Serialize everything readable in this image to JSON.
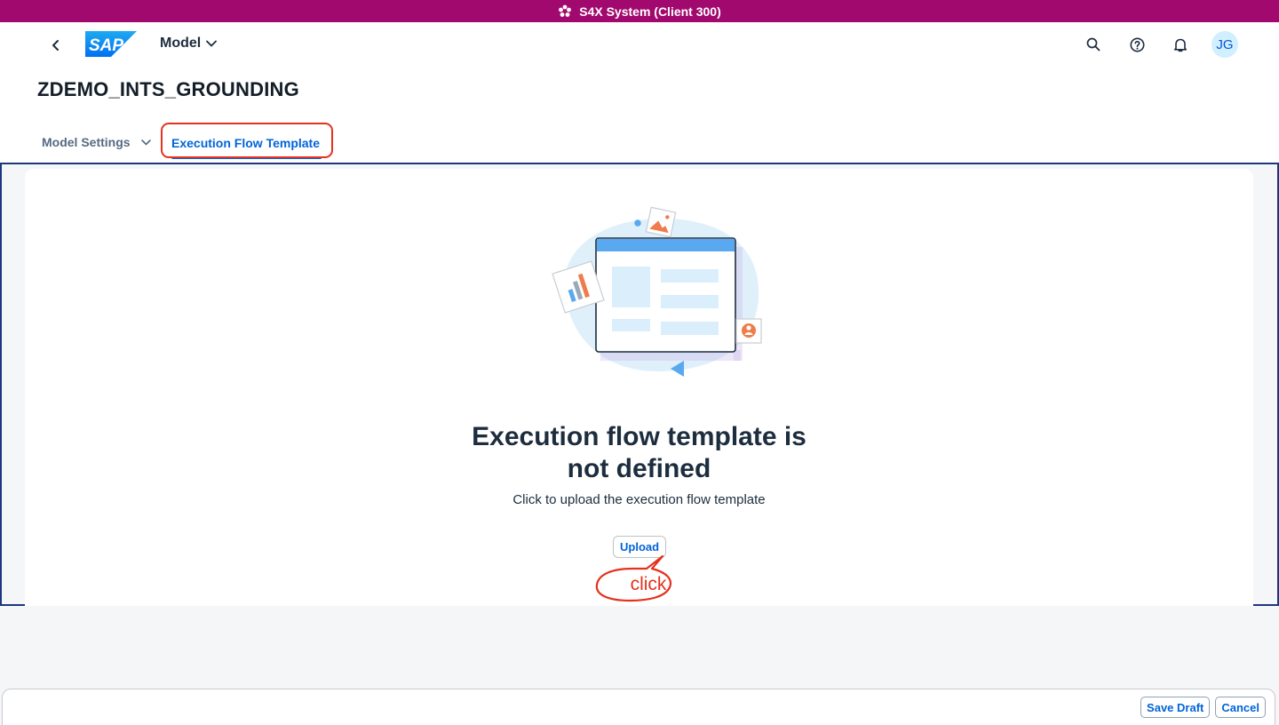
{
  "system_bar": {
    "title": "S4X System (Client 300)",
    "color": "#a2096f",
    "icon": "cube-cluster-icon"
  },
  "shell": {
    "back_icon": "chevron-left-icon",
    "logo_text": "SAP",
    "app_menu_label": "Model",
    "actions": [
      "search-icon",
      "help-icon",
      "bell-icon"
    ],
    "avatar_initials": "JG"
  },
  "object_header": {
    "title": "ZDEMO_INTS_GROUNDING"
  },
  "tabs": [
    {
      "label": "Model Settings",
      "has_dropdown": true,
      "selected": false
    },
    {
      "label": "Execution Flow Template",
      "selected": true
    }
  ],
  "empty_state": {
    "title_line1": "Execution flow template is",
    "title_line2": "not defined",
    "subtitle": "Click to upload the execution flow template",
    "upload_label": "Upload",
    "annotation": "click",
    "annotation_color": "#e4321e"
  },
  "footer": {
    "save_draft_label": "Save Draft",
    "cancel_label": "Cancel"
  },
  "colors": {
    "accent": "#0064d9",
    "highlight": "#e4321e",
    "frame": "#1e3680"
  }
}
